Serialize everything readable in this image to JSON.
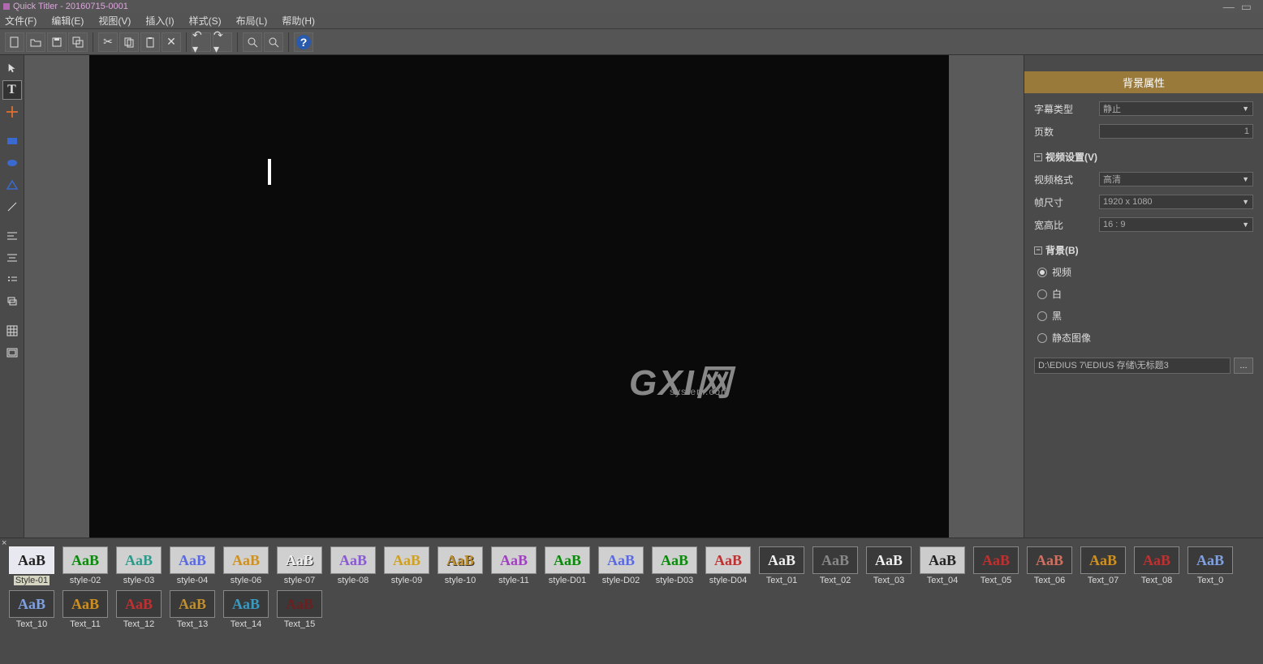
{
  "title": "Quick Titler - 20160715-0001",
  "menu": {
    "file": "文件(F)",
    "edit": "编辑(E)",
    "view": "视图(V)",
    "insert": "插入(I)",
    "style": "样式(S)",
    "layout": "布局(L)",
    "help": "帮助(H)"
  },
  "props": {
    "panel_title": "背景属性",
    "subtitle_type_label": "字幕类型",
    "subtitle_type_value": "静止",
    "pages_label": "页数",
    "pages_value": "1",
    "video_section": "视频设置(V)",
    "video_format_label": "视频格式",
    "video_format_value": "高清",
    "frame_size_label": "帧尺寸",
    "frame_size_value": "1920 x 1080",
    "aspect_label": "宽高比",
    "aspect_value": "16 : 9",
    "bg_section": "背景(B)",
    "radio_video": "视频",
    "radio_white": "白",
    "radio_black": "黑",
    "radio_static": "静态图像",
    "path_value": "D:\\EDIUS 7\\EDIUS 存储\\无标题3",
    "browse": "..."
  },
  "watermark": {
    "big": "GXI网",
    "small": "system.com"
  },
  "styles_row1": [
    {
      "name": "Style-01",
      "sel": true,
      "cls": "sel t-black"
    },
    {
      "name": "style-02",
      "cls": "t-green"
    },
    {
      "name": "style-03",
      "cls": "t-teal"
    },
    {
      "name": "style-04",
      "cls": "t-blue"
    },
    {
      "name": "style-06",
      "cls": "t-orange"
    },
    {
      "name": "style-07",
      "cls": "t-white"
    },
    {
      "name": "style-08",
      "cls": "t-purple"
    },
    {
      "name": "style-09",
      "cls": "t-yellow"
    },
    {
      "name": "style-10",
      "cls": "t-gold"
    },
    {
      "name": "style-11",
      "cls": "t-magenta"
    },
    {
      "name": "style-D01",
      "cls": "t-green"
    },
    {
      "name": "style-D02",
      "cls": "t-blue"
    },
    {
      "name": "style-D03",
      "cls": "t-green"
    },
    {
      "name": "style-D04",
      "cls": "t-red"
    },
    {
      "name": "Text_01",
      "cls": "dark t-white"
    },
    {
      "name": "Text_02",
      "cls": "dark t-gray"
    },
    {
      "name": "Text_03",
      "cls": "dark t-white"
    },
    {
      "name": "Text_04",
      "cls": "dark t-black",
      "bg": "#ccc"
    },
    {
      "name": "Text_05",
      "cls": "dark t-red"
    },
    {
      "name": "Text_06",
      "cls": "dark t-salmon"
    },
    {
      "name": "Text_07",
      "cls": "dark t-orange"
    },
    {
      "name": "Text_08",
      "cls": "dark t-red"
    },
    {
      "name": "Text_0",
      "cls": "dark t-ltblue"
    }
  ],
  "styles_row2": [
    {
      "name": "Text_10",
      "cls": "dark t-ltblue"
    },
    {
      "name": "Text_11",
      "cls": "dark t-orange"
    },
    {
      "name": "Text_12",
      "cls": "dark t-red"
    },
    {
      "name": "Text_13",
      "cls": "dark t-gold"
    },
    {
      "name": "Text_14",
      "cls": "dark t-cyan"
    },
    {
      "name": "Text_15",
      "cls": "dark t-darkred"
    }
  ],
  "thumb_text": "AaB"
}
